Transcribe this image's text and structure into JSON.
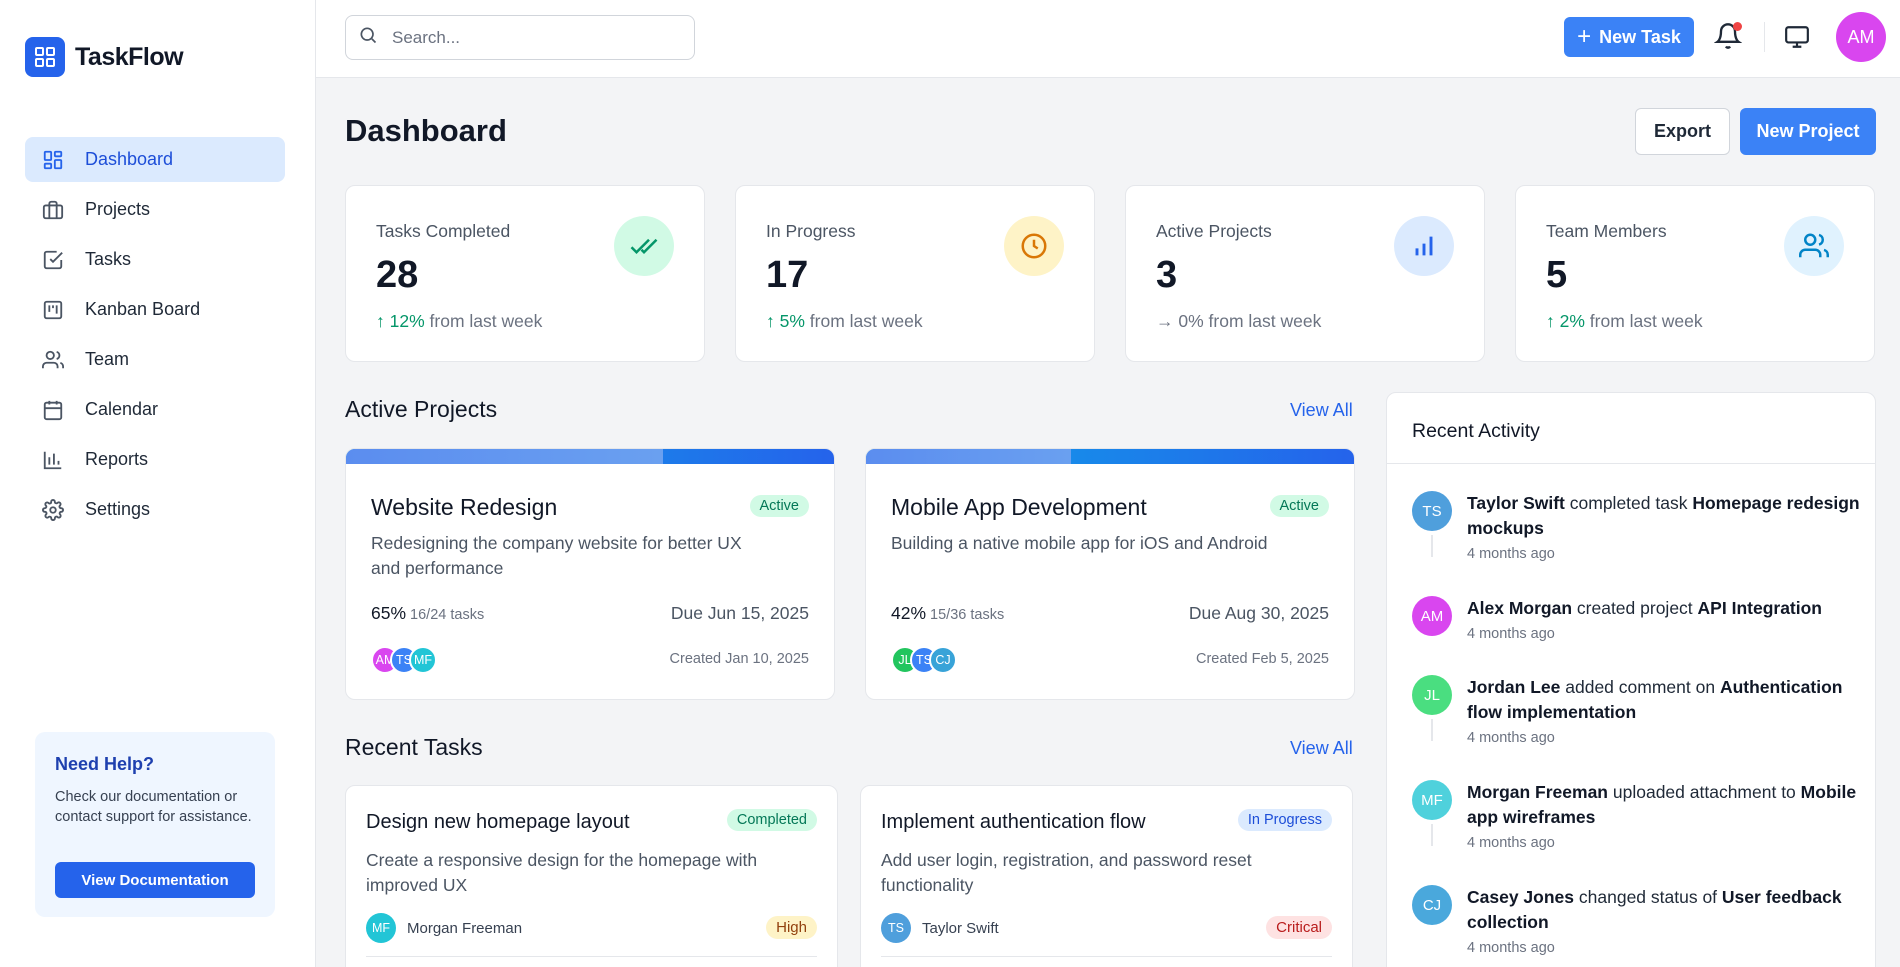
{
  "app": {
    "name": "TaskFlow"
  },
  "sidebar": {
    "items": [
      {
        "label": "Dashboard",
        "icon": "dashboard-icon",
        "active": true
      },
      {
        "label": "Projects",
        "icon": "briefcase-icon"
      },
      {
        "label": "Tasks",
        "icon": "checkbox-icon"
      },
      {
        "label": "Kanban Board",
        "icon": "kanban-icon"
      },
      {
        "label": "Team",
        "icon": "users-icon"
      },
      {
        "label": "Calendar",
        "icon": "calendar-icon"
      },
      {
        "label": "Reports",
        "icon": "bar-chart-icon"
      },
      {
        "label": "Settings",
        "icon": "gear-icon"
      }
    ],
    "help": {
      "title": "Need Help?",
      "text": "Check our documentation or contact support for assistance.",
      "button": "View Documentation"
    }
  },
  "topbar": {
    "search_placeholder": "Search...",
    "new_task_label": "New Task",
    "user_initials": "AM"
  },
  "header": {
    "title": "Dashboard",
    "export_label": "Export",
    "new_project_label": "New Project"
  },
  "stats": [
    {
      "label": "Tasks Completed",
      "value": "28",
      "arrow": "↑",
      "change": "12%",
      "suffix": "from last week",
      "icon": "double-check-icon",
      "color": "#059669"
    },
    {
      "label": "In Progress",
      "value": "17",
      "arrow": "↑",
      "change": "5%",
      "suffix": "from last week",
      "icon": "clock-icon",
      "color": "#d97706"
    },
    {
      "label": "Active Projects",
      "value": "3",
      "arrow": "→",
      "change": "0%",
      "suffix": "from last week",
      "icon": "bar-chart-icon",
      "color": "#2563eb"
    },
    {
      "label": "Team Members",
      "value": "5",
      "arrow": "↑",
      "change": "2%",
      "suffix": "from last week",
      "icon": "users-icon",
      "color": "#0284c7"
    }
  ],
  "active_projects": {
    "title": "Active Projects",
    "view_all": "View All",
    "items": [
      {
        "name": "Website Redesign",
        "status": "Active",
        "description": "Redesigning the company website for better UX and performance",
        "progress": "65%",
        "progress_fraction": 0.65,
        "tasks": "16/24 tasks",
        "due": "Due Jun 15, 2025",
        "created": "Created Jan 10, 2025",
        "members": [
          {
            "initials": "AM",
            "color": "#d946ef"
          },
          {
            "initials": "TS",
            "color": "#3b82f6"
          },
          {
            "initials": "MF",
            "color": "#22c5d6"
          }
        ]
      },
      {
        "name": "Mobile App Development",
        "status": "Active",
        "description": "Building a native mobile app for iOS and Android",
        "progress": "42%",
        "progress_fraction": 0.42,
        "tasks": "15/36 tasks",
        "due": "Due Aug 30, 2025",
        "created": "Created Feb 5, 2025",
        "members": [
          {
            "initials": "JL",
            "color": "#22c55e"
          },
          {
            "initials": "TS",
            "color": "#3b82f6"
          },
          {
            "initials": "CJ",
            "color": "#38a3d8"
          }
        ]
      }
    ]
  },
  "recent_tasks": {
    "title": "Recent Tasks",
    "view_all": "View All",
    "items": [
      {
        "name": "Design new homepage layout",
        "status": "Completed",
        "description": "Create a responsive design for the homepage with improved UX",
        "assignee": "Morgan Freeman",
        "initials": "MF",
        "avatar_color": "#22c5d6",
        "priority": "High"
      },
      {
        "name": "Implement authentication flow",
        "status": "In Progress",
        "description": "Add user login, registration, and password reset functionality",
        "assignee": "Taylor Swift",
        "initials": "TS",
        "avatar_color": "#4f9fdc",
        "priority": "Critical"
      }
    ]
  },
  "activity": {
    "title": "Recent Activity",
    "items": [
      {
        "initials": "TS",
        "color": "#4f9fdc",
        "user": "Taylor Swift",
        "action": "completed task",
        "target": "Homepage redesign mockups",
        "time": "4 months ago"
      },
      {
        "initials": "AM",
        "color": "#d946ef",
        "user": "Alex Morgan",
        "action": "created project",
        "target": "API Integration",
        "time": "4 months ago"
      },
      {
        "initials": "JL",
        "color": "#4ade80",
        "user": "Jordan Lee",
        "action": "added comment on",
        "target": "Authentication flow implementation",
        "time": "4 months ago"
      },
      {
        "initials": "MF",
        "color": "#4fd1dc",
        "user": "Morgan Freeman",
        "action": "uploaded attachment to",
        "target": "Mobile app wireframes",
        "time": "4 months ago"
      },
      {
        "initials": "CJ",
        "color": "#4aa8dc",
        "user": "Casey Jones",
        "action": "changed status of",
        "target": "User feedback collection",
        "time": "4 months ago"
      }
    ]
  }
}
